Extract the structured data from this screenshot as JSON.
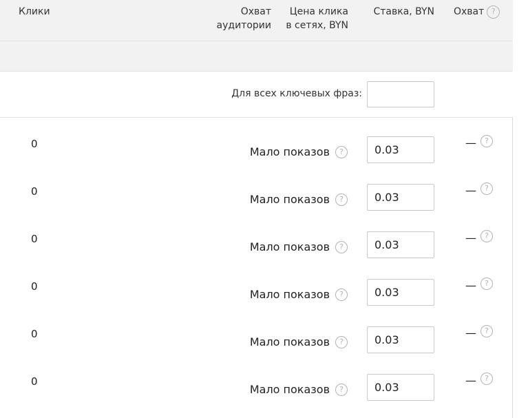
{
  "header": {
    "clicks": "Клики",
    "reach_line1": "Охват",
    "reach_line2": "аудитории",
    "price_line1": "Цена клика",
    "price_line2": "в сетях, BYN",
    "bid": "Ставка, BYN",
    "reach2": "Охват",
    "help_glyph": "?"
  },
  "all_phrases": {
    "label": "Для всех ключевых фраз:",
    "value": ""
  },
  "rows": [
    {
      "clicks": "0",
      "status": "Мало показов",
      "bid": "0.03",
      "reach": "—"
    },
    {
      "clicks": "0",
      "status": "Мало показов",
      "bid": "0.03",
      "reach": "—"
    },
    {
      "clicks": "0",
      "status": "Мало показов",
      "bid": "0.03",
      "reach": "—"
    },
    {
      "clicks": "0",
      "status": "Мало показов",
      "bid": "0.03",
      "reach": "—"
    },
    {
      "clicks": "0",
      "status": "Мало показов",
      "bid": "0.03",
      "reach": "—"
    },
    {
      "clicks": "0",
      "status": "Мало показов",
      "bid": "0.03",
      "reach": "—"
    }
  ],
  "colors": {
    "header_bg": "#f2f2f2",
    "border": "#c9c9c9",
    "help_icon": "#b3b3b3",
    "text": "#222222"
  },
  "icons": {
    "help": "question-circle-icon"
  }
}
